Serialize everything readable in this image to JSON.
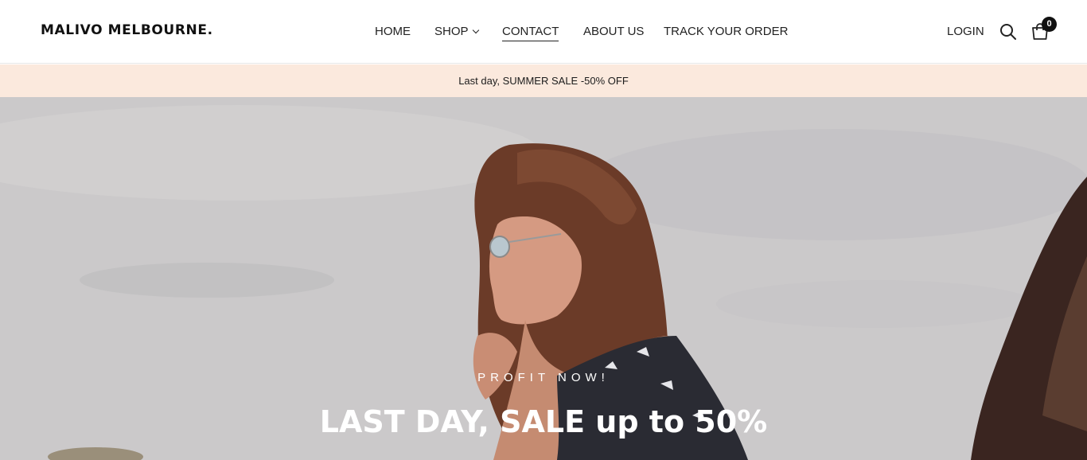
{
  "brand": {
    "logo_text": "MALIVO MELBOURNE."
  },
  "nav": {
    "items": [
      {
        "label": "HOME"
      },
      {
        "label": "SHOP",
        "has_dropdown": true
      },
      {
        "label": "CONTACT",
        "active": true
      },
      {
        "label": "ABOUT US"
      },
      {
        "label": "TRACK YOUR ORDER"
      }
    ]
  },
  "header_actions": {
    "login_label": "LOGIN",
    "search_icon": "search-icon",
    "cart_icon": "cart-icon",
    "cart_count": "0"
  },
  "announcement": {
    "text": "Last day, SUMMER SALE -50% OFF",
    "background": "#fbe9dd"
  },
  "hero": {
    "eyebrow": "PROFIT NOW!",
    "title": "LAST DAY, SALE up to 50%",
    "image_description_icon": "hero-photo"
  },
  "colors": {
    "text": "#111111",
    "announce_bg": "#fbe9dd",
    "hero_text": "#ffffff"
  }
}
